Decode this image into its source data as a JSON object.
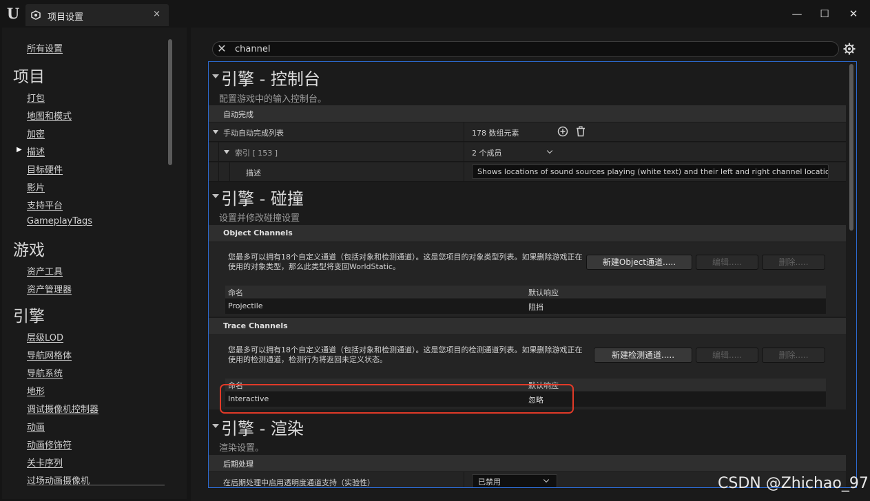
{
  "window": {
    "tab_title": "项目设置",
    "tab_close": "×",
    "minimize": "—",
    "maximize": "☐",
    "close": "✕"
  },
  "sidebar": {
    "all_settings": "所有设置",
    "categories": [
      {
        "title": "项目",
        "items": [
          "打包",
          "地图和模式",
          "加密",
          "描述",
          "目标硬件",
          "影片",
          "支持平台",
          "GameplayTags"
        ]
      },
      {
        "title": "游戏",
        "items": [
          "资产工具",
          "资产管理器"
        ]
      },
      {
        "title": "引擎",
        "items": [
          "层级LOD",
          "导航网格体",
          "导航系统",
          "地形",
          "调试摄像机控制器",
          "动画",
          "动画修饰符",
          "关卡序列",
          "过场动画摄像机"
        ]
      }
    ],
    "active_item": "描述"
  },
  "search": {
    "value": "channel",
    "clear_icon": "✕"
  },
  "sections": {
    "console": {
      "title": "引擎 - 控制台",
      "desc": "配置游戏中的输入控制台。",
      "category": "自动完成",
      "manual_list_label": "手动自动完成列表",
      "manual_list_value": "178 数组元素",
      "index_label": "索引 [ 153 ]",
      "index_value": "2 个成员",
      "desc_label": "描述",
      "desc_value": "Shows locations of sound sources playing (white text) and their left and right channel locations res"
    },
    "collision": {
      "title": "引擎 - 碰撞",
      "desc": "设置并修改碰撞设置",
      "object_channels": {
        "label": "Object Channels",
        "note": "您最多可以拥有18个自定义通道（包括对象和检测通道）。这是您项目的对象类型列表。如果删除游戏正在使用的对象类型，那么此类型将变回WorldStatic。",
        "new_button": "新建Object通道.....",
        "edit_button": "编辑.....",
        "delete_button": "删除.....",
        "col_name": "命名",
        "col_response": "默认响应",
        "rows": [
          {
            "name": "Projectile",
            "response": "阻挡"
          }
        ]
      },
      "trace_channels": {
        "label": "Trace Channels",
        "note": "您最多可以拥有18个自定义通道（包括对象和检测通道）。这是您项目的检测通道列表。如果删除游戏正在使用的检测通道，检测行为将返回未定义状态。",
        "new_button": "新建检测通道.....",
        "edit_button": "编辑.....",
        "delete_button": "删除.....",
        "col_name": "命名",
        "col_response": "默认响应",
        "rows": [
          {
            "name": "Interactive",
            "response": "忽略"
          }
        ]
      }
    },
    "rendering": {
      "title": "引擎 - 渲染",
      "desc": "渲染设置。",
      "category": "后期处理",
      "setting_label": "在后期处理中启用透明度通道支持（实验性）",
      "setting_value": "已禁用"
    }
  },
  "watermark": "CSDN @Zhichao_97",
  "colors": {
    "accent_border": "#2c6ad0",
    "highlight": "#e23a28"
  },
  "icons": {
    "logo": "unreal-logo-icon",
    "settings_tab": "settings-cube-icon",
    "add": "add-circle-icon",
    "delete": "trash-icon",
    "gear": "gear-icon"
  }
}
